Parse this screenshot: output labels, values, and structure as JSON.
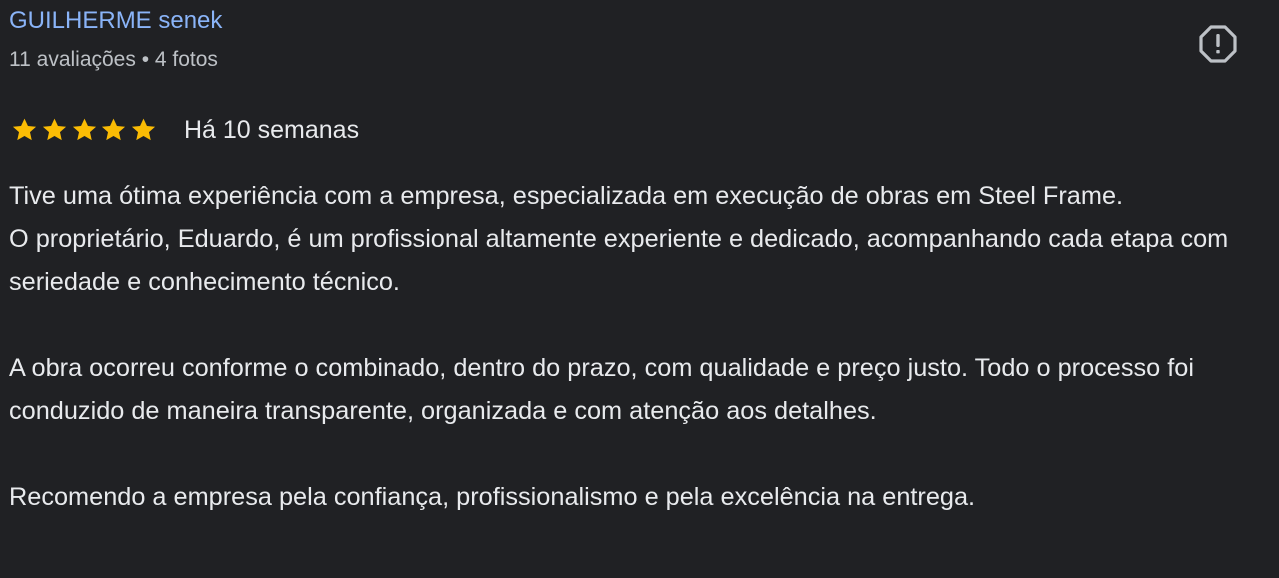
{
  "reviewer": {
    "name": "GUILHERME senek",
    "meta": "11 avaliações • 4 fotos"
  },
  "report": {
    "icon": "report-icon"
  },
  "rating": {
    "value": 5,
    "max": 5,
    "star_color": "#fbbc04",
    "date": "Há 10 semanas"
  },
  "review": {
    "paragraph_1_line_1": "Tive uma ótima experiência com a empresa, especializada em execução de obras em Steel Frame.",
    "paragraph_1_line_2": "O proprietário, Eduardo, é um profissional altamente experiente e dedicado, acompanhando cada etapa com seriedade e conhecimento técnico.",
    "paragraph_2": "A obra ocorreu conforme o combinado, dentro do prazo, com qualidade e preço justo. Todo o processo foi conduzido de maneira transparente, organizada e com atenção aos detalhes.",
    "paragraph_3": "Recomendo a empresa pela confiança, profissionalismo e pela excelência na entrega."
  }
}
